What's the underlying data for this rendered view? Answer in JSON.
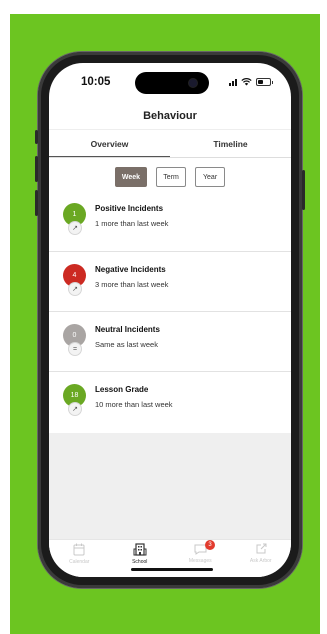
{
  "status_bar": {
    "time": "10:05",
    "battery_level": 0.45
  },
  "header": {
    "title": "Behaviour"
  },
  "tabs": [
    {
      "label": "Overview",
      "active": true
    },
    {
      "label": "Timeline",
      "active": false
    }
  ],
  "period": [
    {
      "label": "Week",
      "active": true
    },
    {
      "label": "Term",
      "active": false
    },
    {
      "label": "Year",
      "active": false
    }
  ],
  "items": [
    {
      "count": "1",
      "title": "Positive Incidents",
      "subtitle": "1 more than last week",
      "color": "#6aa823",
      "trend": "↗",
      "trend_icon": "trend-up-icon"
    },
    {
      "count": "4",
      "title": "Negative Incidents",
      "subtitle": "3 more than last week",
      "color": "#cc2a22",
      "trend": "↗",
      "trend_icon": "trend-up-icon"
    },
    {
      "count": "0",
      "title": "Neutral Incidents",
      "subtitle": "Same as last week",
      "color": "#a9a5a3",
      "trend": "=",
      "trend_icon": "equal-icon"
    },
    {
      "count": "18",
      "title": "Lesson Grade",
      "subtitle": "10 more than last week",
      "color": "#6aa823",
      "trend": "↗",
      "trend_icon": "trend-up-icon"
    }
  ],
  "bottom_nav": [
    {
      "label": "Calendar",
      "icon": "calendar-icon",
      "glyph": "▦",
      "active": false
    },
    {
      "label": "School",
      "icon": "school-icon",
      "glyph": "▥",
      "active": true
    },
    {
      "label": "Messages",
      "icon": "messages-icon",
      "glyph": "✉",
      "active": false,
      "badge": "3"
    },
    {
      "label": "Ask Arbor",
      "icon": "ask-arbor-icon",
      "glyph": "↗",
      "active": false
    }
  ],
  "colors": {
    "background": "#6cc521",
    "active_period": "#7a6f68"
  }
}
